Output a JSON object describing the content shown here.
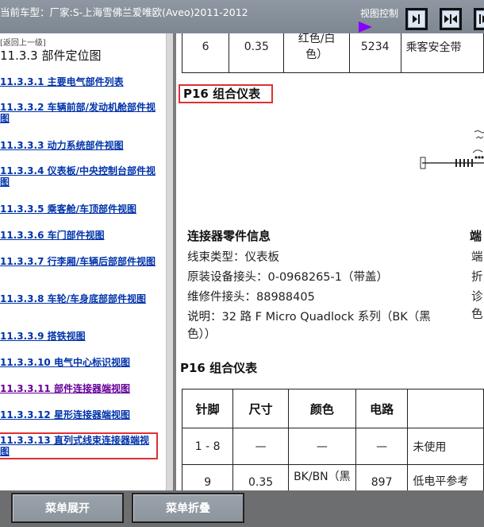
{
  "header": {
    "vehicle_label": "当前车型：厂家:S-上海雪佛兰爱唯欧(Aveo)2011-2012",
    "view_control_label": "视图控制",
    "view_buttons": [
      "panel-right-icon",
      "panel-collapse-icon",
      "panel-expand-icon"
    ]
  },
  "sidebar": {
    "back_link": "[返回上一级]",
    "section_title": "11.3.3 部件定位图",
    "items": [
      {
        "label": "11.3.3.1 主要电气部件列表"
      },
      {
        "label": "11.3.3.2 车辆前部/发动机舱部件视图"
      },
      {
        "label": "11.3.3.3 动力系统部件视图"
      },
      {
        "label": "11.3.3.4 仪表板/中央控制台部件视图"
      },
      {
        "label": "11.3.3.5 乘客舱/车顶部件视图"
      },
      {
        "label": "11.3.3.6 车门部件视图"
      },
      {
        "label": "11.3.3.7 行李厢/车辆后部部件视图"
      },
      {
        "label": "11.3.3.8 车轮/车身底部部件视图"
      },
      {
        "label": "11.3.3.9 搭铁视图"
      },
      {
        "label": "11.3.3.10 电气中心标识视图"
      },
      {
        "label": "11.3.3.11 部件连接器端视图"
      },
      {
        "label": "11.3.3.12 星形连接器端视图"
      },
      {
        "label": "11.3.3.13 直列式线束连接器端视图"
      }
    ]
  },
  "main": {
    "prev_row": {
      "pin": "6",
      "size": "0.35",
      "color_line1": "红色/白",
      "color_line2": "色）",
      "circuit": "5234",
      "function": "乘客安全带"
    },
    "connector_title": "P16 组合仪表",
    "info": {
      "heading": "连接器零件信息",
      "lines": [
        "线束类型：仪表板",
        "原装设备接头：0-0968265-1（带盖）",
        "维修件接头：88988405",
        "说明：32 路 F Micro Quadlock 系列（BK（黑",
        "色））"
      ]
    },
    "right_column": {
      "heading": "端",
      "frags": [
        "端",
        "折",
        "诊",
        "色"
      ]
    },
    "pin_table_title": "P16 组合仪表",
    "pin_table": {
      "headers": [
        "针脚",
        "尺寸",
        "颜色",
        "电路",
        ""
      ],
      "rows": [
        {
          "pin": "1 - 8",
          "size": "—",
          "color": "—",
          "circuit": "—",
          "function": "未使用"
        },
        {
          "pin": "9",
          "size": "0.35",
          "color": "BK/BN（黑",
          "circuit": "897",
          "function": "低电平参考"
        }
      ]
    }
  },
  "footer": {
    "expand_label": "菜单展开",
    "collapse_label": "菜单折叠"
  }
}
